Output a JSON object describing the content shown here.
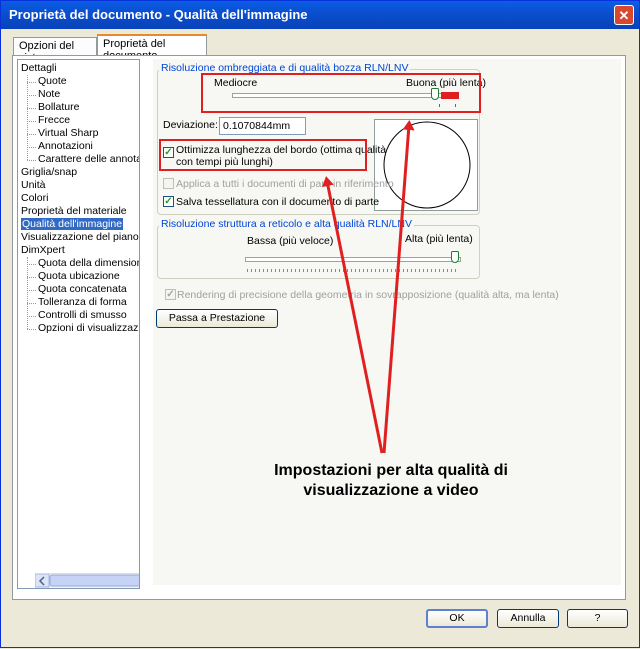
{
  "window": {
    "title": "Proprietà del documento - Qualità dell'immagine"
  },
  "tabs": [
    {
      "label": "Opzioni del sistema",
      "active": false
    },
    {
      "label": "Proprietà del documento",
      "active": true
    }
  ],
  "tree": {
    "items": [
      {
        "label": "Dettagli",
        "level": 0,
        "selected": false
      },
      {
        "label": "Quote",
        "level": 1,
        "selected": false
      },
      {
        "label": "Note",
        "level": 1,
        "selected": false
      },
      {
        "label": "Bollature",
        "level": 1,
        "selected": false
      },
      {
        "label": "Frecce",
        "level": 1,
        "selected": false
      },
      {
        "label": "Virtual Sharp",
        "level": 1,
        "selected": false
      },
      {
        "label": "Annotazioni",
        "level": 1,
        "selected": false
      },
      {
        "label": "Carattere delle annotazio",
        "level": 1,
        "selected": false
      },
      {
        "label": "Griglia/snap",
        "level": 0,
        "selected": false
      },
      {
        "label": "Unità",
        "level": 0,
        "selected": false
      },
      {
        "label": "Colori",
        "level": 0,
        "selected": false
      },
      {
        "label": "Proprietà del materiale",
        "level": 0,
        "selected": false
      },
      {
        "label": "Qualità dell'immagine",
        "level": 0,
        "selected": true
      },
      {
        "label": "Visualizzazione del piano",
        "level": 0,
        "selected": false
      },
      {
        "label": "DimXpert",
        "level": 0,
        "selected": false
      },
      {
        "label": "Quota della dimensione",
        "level": 1,
        "selected": false
      },
      {
        "label": "Quota ubicazione",
        "level": 1,
        "selected": false
      },
      {
        "label": "Quota concatenata",
        "level": 1,
        "selected": false
      },
      {
        "label": "Tolleranza di forma",
        "level": 1,
        "selected": false
      },
      {
        "label": "Controlli di smusso",
        "level": 1,
        "selected": false
      },
      {
        "label": "Opzioni di visualizzazione",
        "level": 1,
        "selected": false
      }
    ]
  },
  "shaded": {
    "group_title": "Risoluzione ombreggiata e di qualità bozza RLN/LNV",
    "low_label": "Mediocre",
    "high_label": "Buona (più lenta)",
    "slider_level": 0.9,
    "deviation_label": "Deviazione:",
    "deviation_value": "0.1070844mm",
    "optimize_label_1": "Ottimizza lunghezza del bordo (ottima qualità",
    "optimize_label_2": "con tempi più lunghi)",
    "optimize_checked": true,
    "apply_all_label": "Applica a tutti i documenti di parti in riferimento",
    "apply_all_checked": false,
    "save_tess_label": "Salva tessellatura con il documento di parte",
    "save_tess_checked": true
  },
  "wireframe": {
    "group_title": "Risoluzione struttura a reticolo e alta qualità RLN/LNV",
    "low_label": "Bassa (più veloce)",
    "high_label": "Alta (più lenta)",
    "slider_level": 0.98
  },
  "precision_label": "Rendering di precisione della geometria in sovrapposizione (qualità alta, ma lenta)",
  "precision_checked": true,
  "performance_button": "Passa a Prestazione",
  "buttons": {
    "ok": "OK",
    "cancel": "Annulla",
    "help": "?"
  },
  "annotation": {
    "line1": "Impostazioni per alta qualità di",
    "line2": "visualizzazione a video"
  },
  "colors": {
    "accent_red": "#e02020",
    "title_blue": "#0a5ee6",
    "selection": "#316ac5"
  }
}
